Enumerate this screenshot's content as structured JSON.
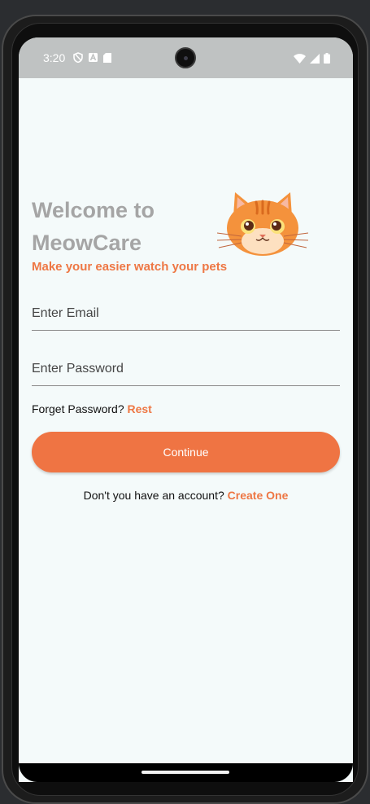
{
  "status_bar": {
    "time": "3:20"
  },
  "login": {
    "title": "Welcome to MeowCare",
    "tagline": "Make your easier watch your pets",
    "email_placeholder": "Enter Email",
    "password_placeholder": "Enter Password",
    "forget_text": "Forget Password?",
    "forget_link": "Rest",
    "continue_label": "Continue",
    "account_text": "Don't you have an account?",
    "create_link": "Create One"
  },
  "icons": {
    "logo": "cat-face-icon"
  },
  "colors": {
    "accent": "#ef7443",
    "background": "#f4fafa",
    "title": "#a5a5a5"
  }
}
